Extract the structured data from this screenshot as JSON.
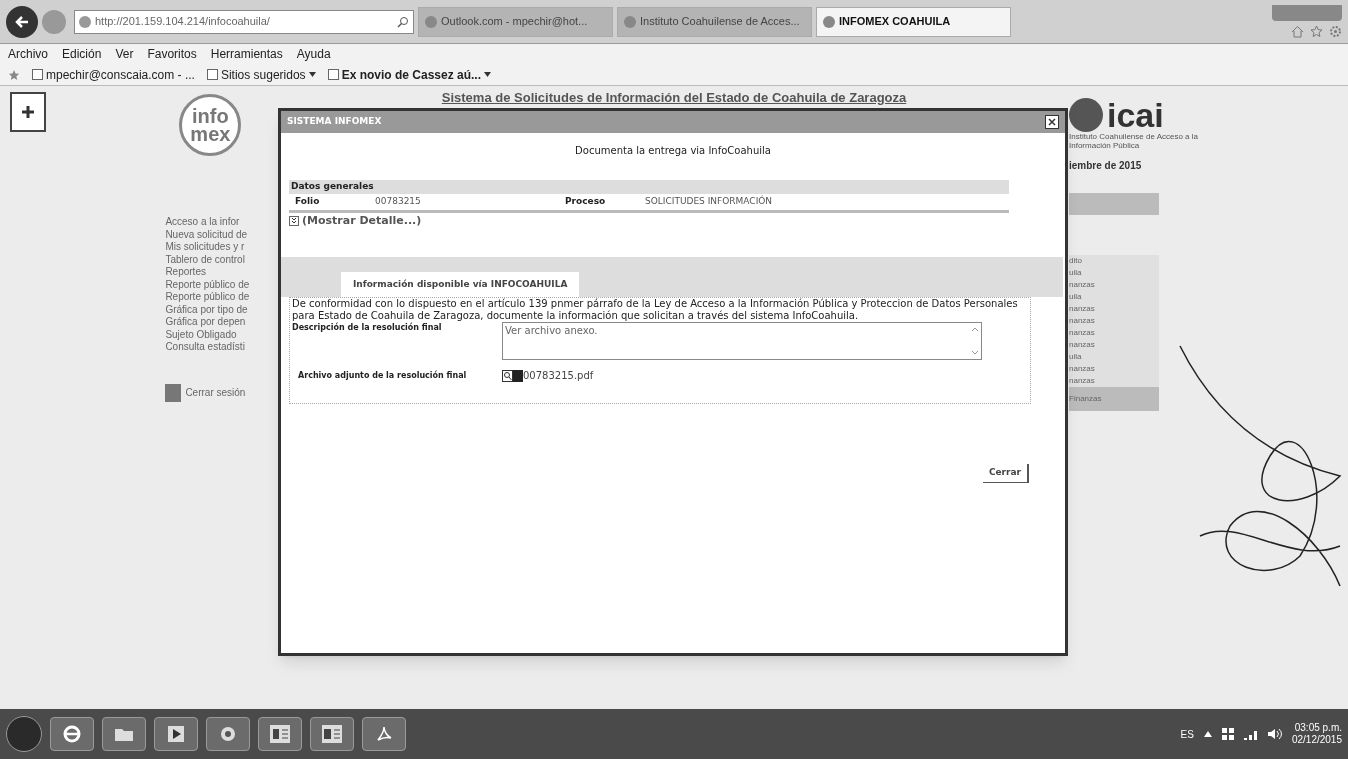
{
  "browser": {
    "address": "http://201.159.104.214/infocoahuila/",
    "tabs": [
      {
        "label": "Outlook.com - mpechir@hot...",
        "selected": false
      },
      {
        "label": "Instituto Coahuilense de Acces...",
        "selected": false
      },
      {
        "label": "INFOMEX COAHUILA",
        "selected": true
      }
    ],
    "menu": [
      "Archivo",
      "Edición",
      "Ver",
      "Favoritos",
      "Herramientas",
      "Ayuda"
    ],
    "favorites": [
      {
        "label": "mpechir@conscaia.com - ...",
        "dropdown": false
      },
      {
        "label": "Sitios sugeridos",
        "dropdown": true
      },
      {
        "label": "Ex novio de Cassez aú...",
        "dropdown": true
      }
    ]
  },
  "page": {
    "logo_left": [
      "info",
      "mex"
    ],
    "header": "Sistema de Solicitudes de Información del Estado de Coahuila de Zaragoza",
    "logo_right": "icai",
    "logo_right_caption": "Instituto Coahuilense de Acceso a la Información Pública",
    "date_fragment": "iembre de 2015",
    "sidebar": [
      "Acceso a la infor",
      "Nueva solicitud de",
      "Mis solicitudes y r",
      "Tablero de control",
      "Reportes",
      "Reporte público de",
      "Reporte público de",
      "Gráfica por tipo de",
      "Gráfica por depen",
      "Sujeto Obligado",
      "Consulta estadísti"
    ],
    "logout": "Cerrar sesión",
    "right_fragments": [
      "dito",
      "uila",
      "nanzas",
      "uila",
      "nanzas",
      "nanzas",
      "nanzas",
      "nanzas",
      "uila",
      "nanzas",
      "nanzas",
      "Finanzas"
    ]
  },
  "dialog": {
    "title": "SISTEMA INFOMEX",
    "heading": "Documenta la entrega via InfoCoahuila",
    "section": "Datos generales",
    "folio_label": "Folio",
    "folio": "00783215",
    "proceso_label": "Proceso",
    "proceso": "SOLICITUDES INFORMACIÓN",
    "details_link": "(Mostrar Detalle...)",
    "tab": "Información disponible vía INFOCOAHUILA",
    "notice": "De conformidad con lo dispuesto en el artículo 139 pnmer párrafo de la Ley de Acceso a la Información Pública y Proteccion de Datos Personales para Estado de Coahuila de Zaragoza, documente la información que solicitan a través del sistema InfoCoahuila.",
    "description_label": "Descripción de la resolución final",
    "description_value": "Ver archivo anexo.",
    "attachment_label": "Archivo adjunto de la resolución final",
    "attachment": "00783215.pdf",
    "close_button": "Cerrar"
  },
  "taskbar": {
    "language": "ES",
    "time": "03:05 p.m.",
    "date": "02/12/2015"
  }
}
